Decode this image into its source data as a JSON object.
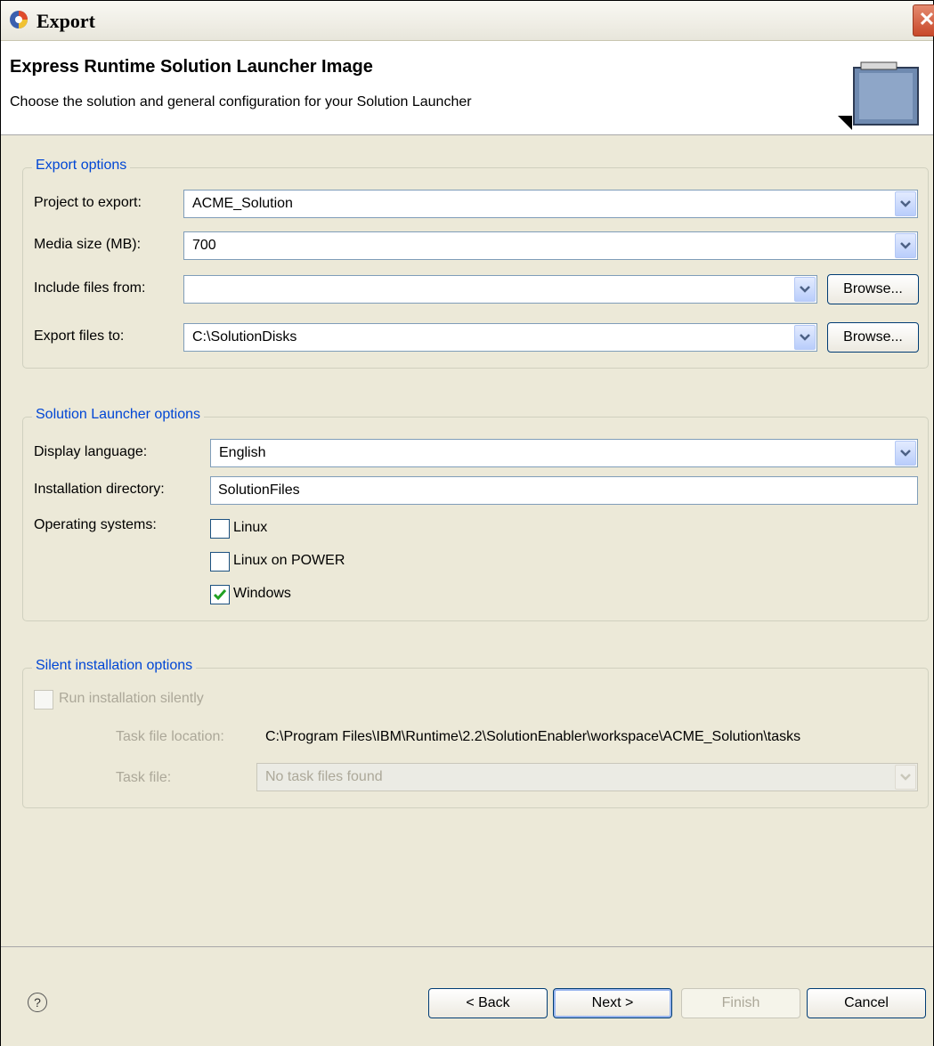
{
  "window": {
    "title": "Export",
    "close_glyph": "✕",
    "app_icon": "eclipse-icon"
  },
  "header": {
    "title": "Express Runtime Solution Launcher Image",
    "description": "Choose the solution and general configuration for your Solution Launcher",
    "image_icon": "export-wizard-icon"
  },
  "export_options": {
    "legend": "Export options",
    "project_label": "Project to export:",
    "project_value": "ACME_Solution",
    "media_label": "Media size (MB):",
    "media_value": "700",
    "include_label": "Include files from:",
    "include_value": "",
    "export_to_label": "Export files to:",
    "export_to_value": "C:\\SolutionDisks",
    "browse_label": "Browse..."
  },
  "launcher_options": {
    "legend": "Solution Launcher options",
    "language_label": "Display language:",
    "language_value": "English",
    "install_dir_label": "Installation directory:",
    "install_dir_value": "SolutionFiles",
    "os_label": "Operating systems:",
    "os": [
      {
        "label": "Linux",
        "checked": false
      },
      {
        "label": "Linux on POWER",
        "checked": false
      },
      {
        "label": "Windows",
        "checked": true
      }
    ]
  },
  "silent_options": {
    "legend": "Silent installation options",
    "run_silently_label": "Run installation silently",
    "run_silently_checked": false,
    "task_location_label": "Task file location:",
    "task_location_value": "C:\\Program Files\\IBM\\Runtime\\2.2\\SolutionEnabler\\workspace\\ACME_Solution\\tasks",
    "task_file_label": "Task file:",
    "task_file_value": "No task files found"
  },
  "footer": {
    "help_glyph": "?",
    "back_label": "< Back",
    "next_label": "Next >",
    "finish_label": "Finish",
    "cancel_label": "Cancel"
  },
  "colors": {
    "accent": "#0046d5",
    "check": "#21a121",
    "face": "#ece9d8"
  }
}
